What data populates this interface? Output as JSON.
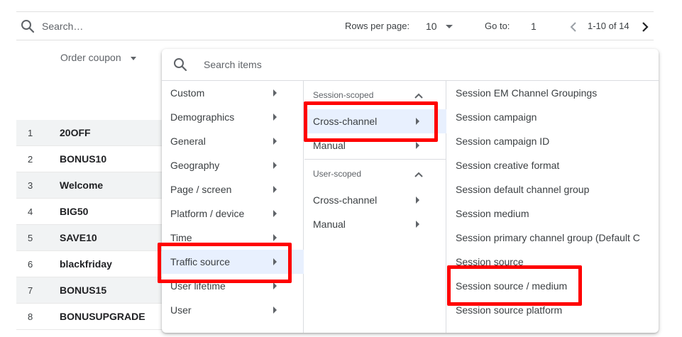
{
  "toolbar": {
    "search_placeholder": "Search…",
    "rows_per_page_label": "Rows per page:",
    "rows_per_page_value": "10",
    "goto_label": "Go to:",
    "goto_value": "1",
    "range": "1-10 of 14"
  },
  "table": {
    "column_header": "Order coupon",
    "rows": [
      {
        "num": "1",
        "coupon": "20OFF"
      },
      {
        "num": "2",
        "coupon": "BONUS10"
      },
      {
        "num": "3",
        "coupon": "Welcome"
      },
      {
        "num": "4",
        "coupon": "BIG50"
      },
      {
        "num": "5",
        "coupon": "SAVE10"
      },
      {
        "num": "6",
        "coupon": "blackfriday"
      },
      {
        "num": "7",
        "coupon": "BONUS15"
      },
      {
        "num": "8",
        "coupon": "BONUSUPGRADE"
      }
    ]
  },
  "picker": {
    "search_placeholder": "Search items",
    "categories": [
      {
        "label": "Custom"
      },
      {
        "label": "Demographics"
      },
      {
        "label": "General"
      },
      {
        "label": "Geography"
      },
      {
        "label": "Page / screen"
      },
      {
        "label": "Platform / device"
      },
      {
        "label": "Time"
      },
      {
        "label": "Traffic source"
      },
      {
        "label": "User lifetime"
      },
      {
        "label": "User"
      }
    ],
    "scopes": {
      "session_heading": "Session-scoped",
      "session_items": [
        {
          "label": "Cross-channel"
        },
        {
          "label": "Manual"
        }
      ],
      "user_heading": "User-scoped",
      "user_items": [
        {
          "label": "Cross-channel"
        },
        {
          "label": "Manual"
        }
      ]
    },
    "dimensions": [
      "Session EM Channel Groupings",
      "Session campaign",
      "Session campaign ID",
      "Session creative format",
      "Session default channel group",
      "Session medium",
      "Session primary channel group (Default C",
      "Session source",
      "Session source / medium",
      "Session source platform"
    ]
  },
  "colors": {
    "highlight": "#ff0000",
    "selected_bg": "#e8f0fe"
  }
}
